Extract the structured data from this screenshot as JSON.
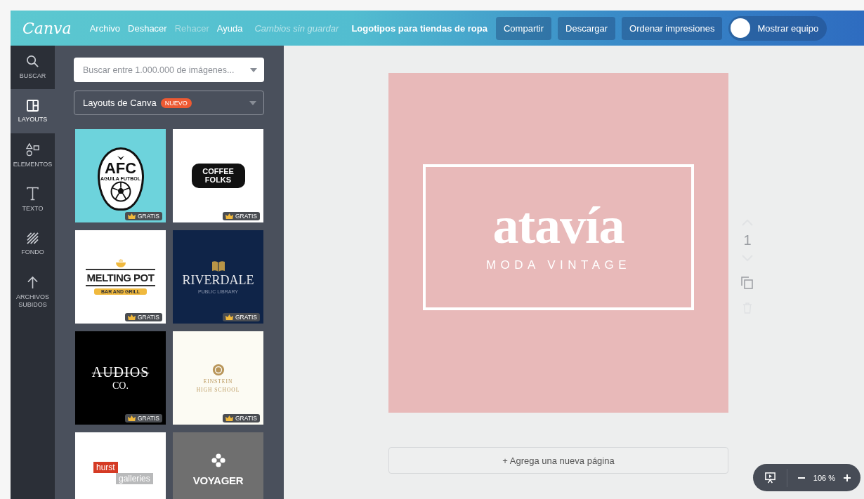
{
  "logo": "Canva",
  "menu": [
    {
      "label": "Archivo",
      "disabled": false
    },
    {
      "label": "Deshacer",
      "disabled": false
    },
    {
      "label": "Rehacer",
      "disabled": true
    },
    {
      "label": "Ayuda",
      "disabled": false
    }
  ],
  "save_status": "Cambios sin guardar",
  "document_title": "Logotipos para tiendas de ropa",
  "actions": [
    "Compartir",
    "Descargar",
    "Ordenar impresiones"
  ],
  "team_toggle": {
    "label": "Mostrar equipo",
    "on": false
  },
  "sidebar": {
    "items": [
      {
        "kind": "search",
        "label": "BUSCAR",
        "selected": false
      },
      {
        "kind": "layouts",
        "label": "LAYOUTS",
        "selected": true
      },
      {
        "kind": "elements",
        "label": "ELEMENTOS",
        "selected": false
      },
      {
        "kind": "text",
        "label": "TEXTO",
        "selected": false
      },
      {
        "kind": "background",
        "label": "FONDO",
        "selected": false
      },
      {
        "kind": "uploads",
        "label": "ARCHIVOS SUBIDOS",
        "selected": false
      }
    ]
  },
  "panel": {
    "search": {
      "placeholder": "Buscar entre 1.000.000 de imágenes..."
    },
    "source_dropdown": {
      "label": "Layouts de Canva",
      "badge": "NUEVO"
    },
    "templates": [
      {
        "kind": "afc",
        "lines": [
          "AFC",
          "AGUILA FUTBOL"
        ],
        "badge": "GRATIS"
      },
      {
        "kind": "coffee",
        "lines": [
          "COFFEE",
          "FOLKS"
        ],
        "badge": "GRATIS"
      },
      {
        "kind": "melting",
        "lines": [
          "MELTING POT",
          "BAR AND GRILL"
        ],
        "badge": "GRATIS"
      },
      {
        "kind": "riverdale",
        "lines": [
          "RIVERDALE",
          "PUBLIC LIBRARY"
        ],
        "badge": "GRATIS"
      },
      {
        "kind": "audios",
        "lines": [
          "AUDIOS",
          "CO."
        ],
        "badge": "GRATIS"
      },
      {
        "kind": "einstein",
        "lines": [
          "EINSTEIN",
          "HIGH SCHOOL"
        ],
        "badge": "GRATIS"
      },
      {
        "kind": "hurst",
        "lines": [
          "hurst",
          "galleries"
        ]
      },
      {
        "kind": "voyager",
        "lines": [
          "VOYAGER"
        ]
      }
    ]
  },
  "canvas": {
    "heading": "atavía",
    "tagline": "MODA VINTAGE",
    "page_number": "1",
    "add_page": "+ Agrega una nueva página"
  },
  "zoom": {
    "value": "106 %"
  }
}
